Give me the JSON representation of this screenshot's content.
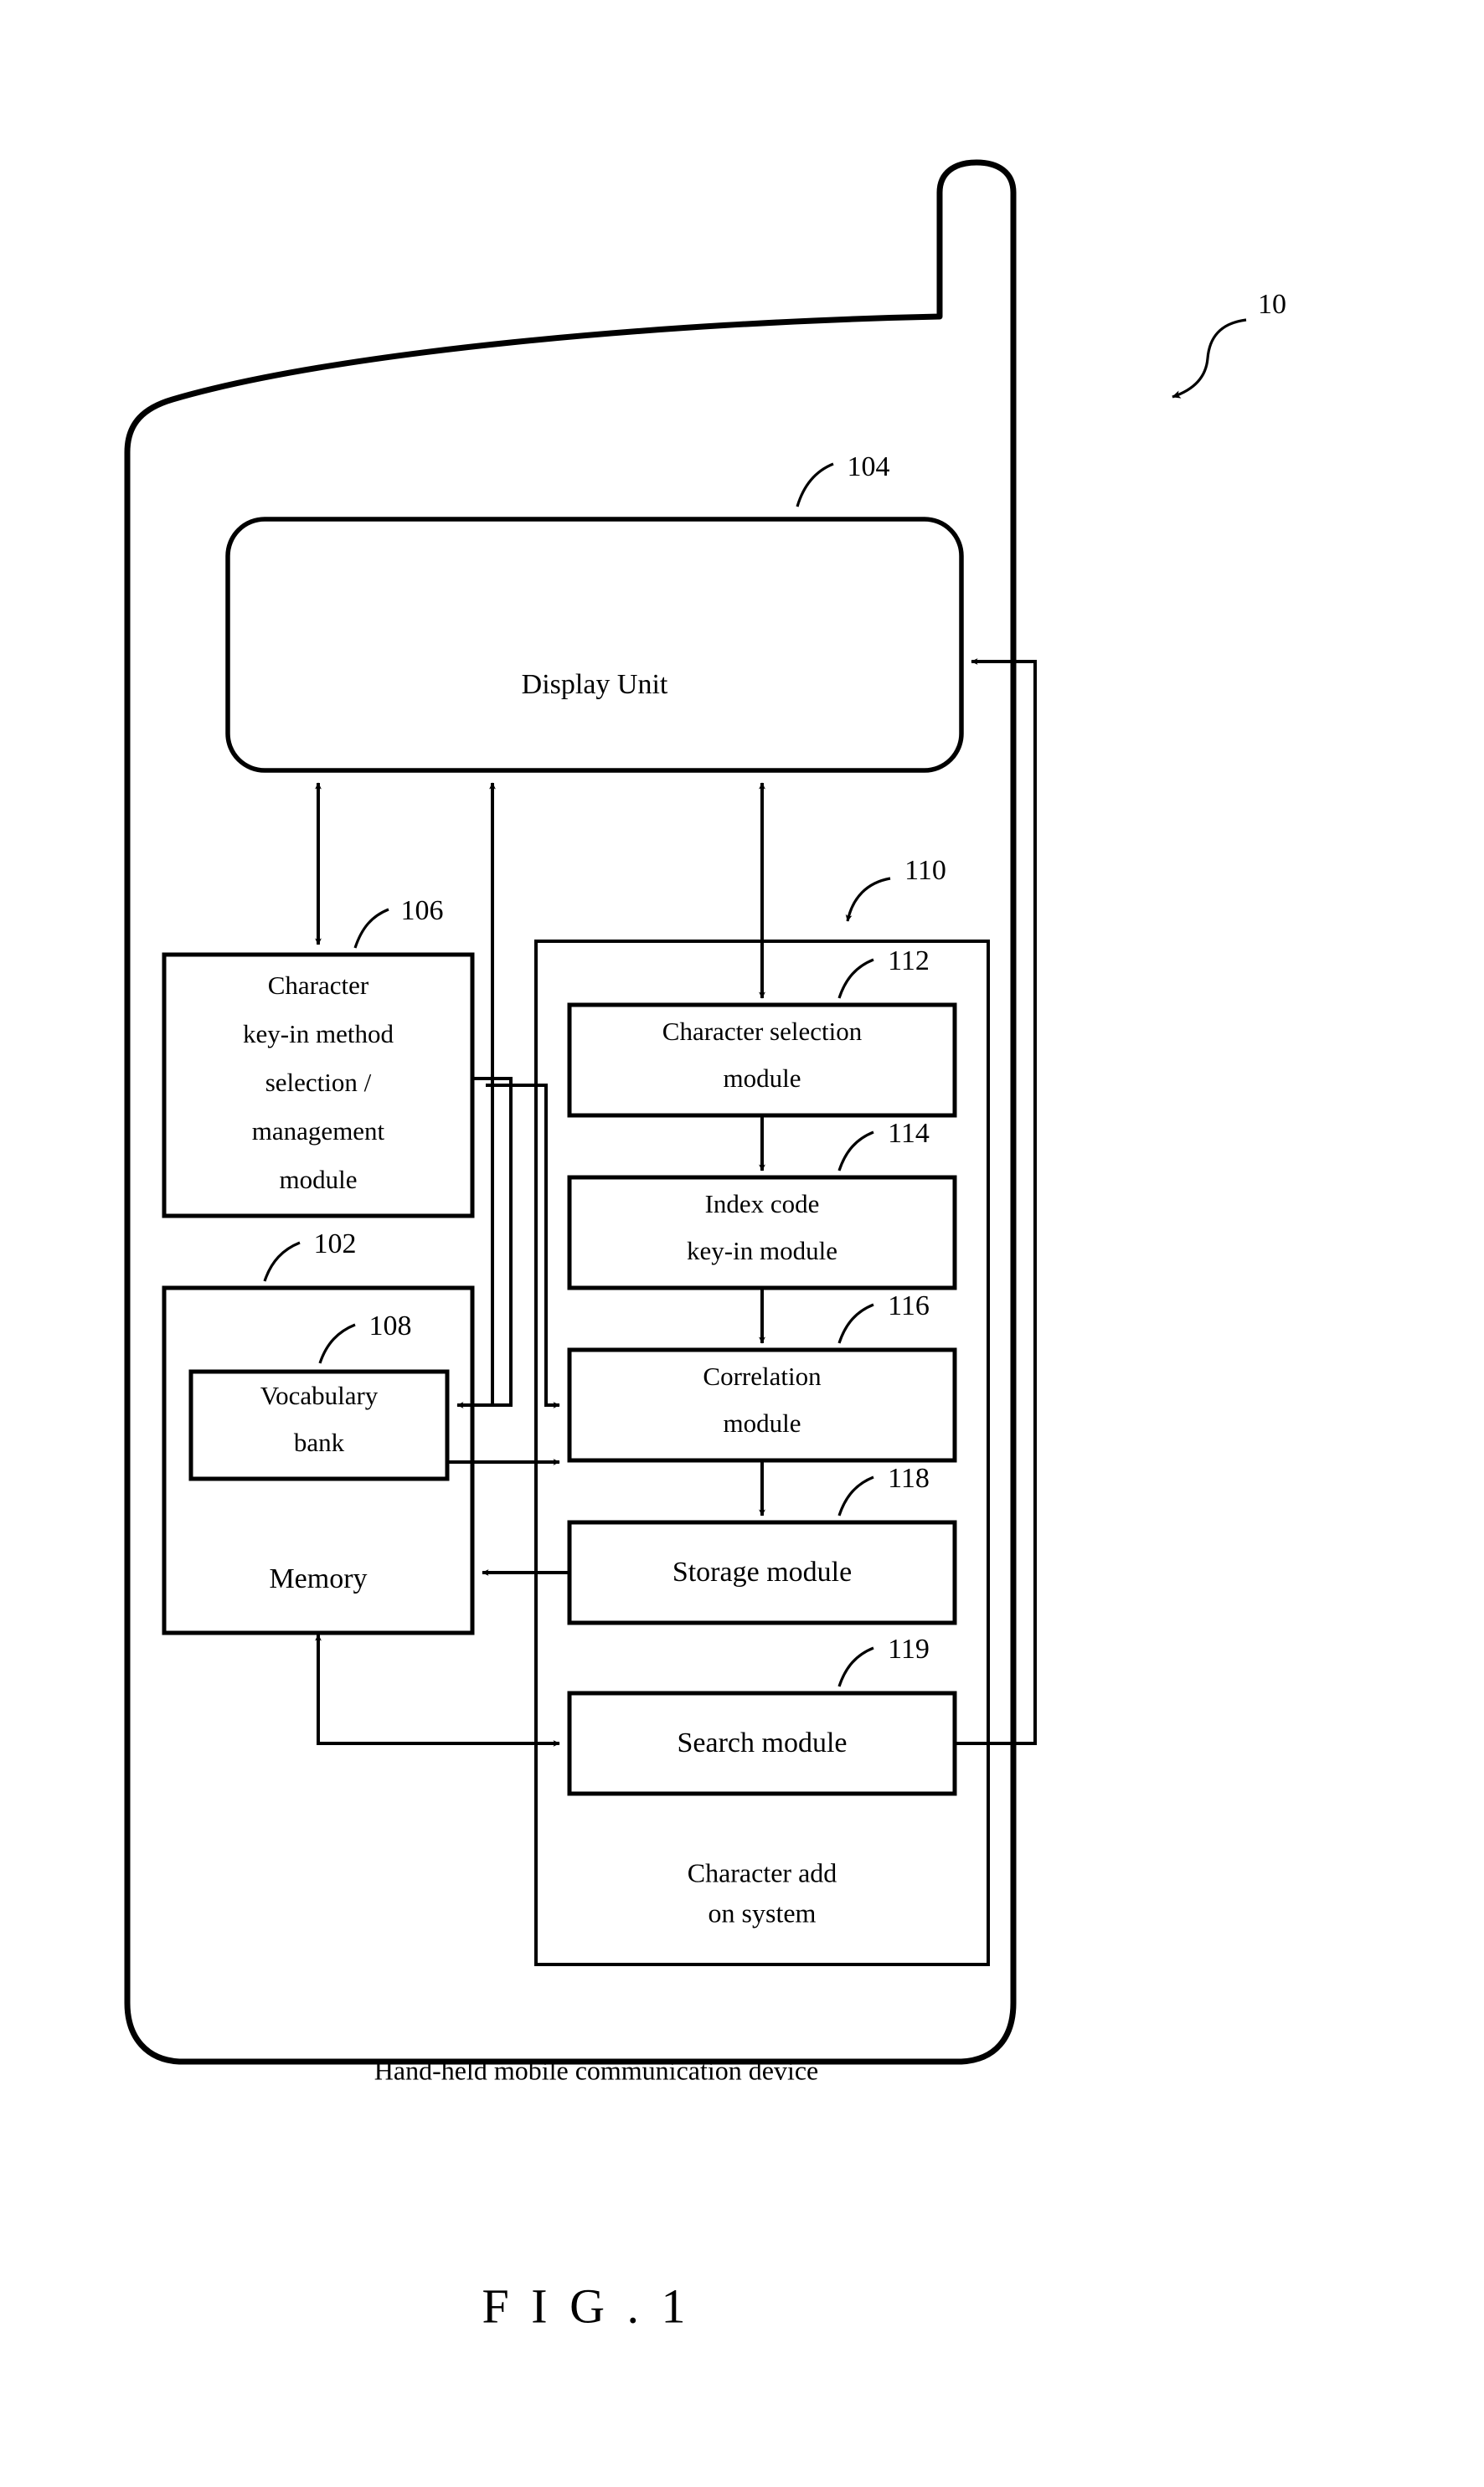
{
  "figure": {
    "caption": "F I G . 1",
    "device_label": "Hand-held mobile communication device",
    "device_ref": "10",
    "system_label_line1": "Character add",
    "system_label_line2": "on system",
    "system_ref": "110"
  },
  "blocks": {
    "display": {
      "label": "Display Unit",
      "ref": "104"
    },
    "keyin_method": {
      "line1": "Character",
      "line2": "key-in method",
      "line3": "selection /",
      "line4": "management",
      "line5": "module",
      "ref": "106"
    },
    "memory": {
      "label": "Memory",
      "ref": "102"
    },
    "vocabulary_bank": {
      "line1": "Vocabulary",
      "line2": "bank",
      "ref": "108"
    },
    "character_selection": {
      "line1": "Character selection",
      "line2": "module",
      "ref": "112"
    },
    "index_code_keyin": {
      "line1": "Index code",
      "line2": "key-in module",
      "ref": "114"
    },
    "correlation": {
      "line1": "Correlation",
      "line2": "module",
      "ref": "116"
    },
    "storage": {
      "label": "Storage module",
      "ref": "118"
    },
    "search": {
      "label": "Search module",
      "ref": "119"
    }
  },
  "colors": {
    "ink": "#000000",
    "paper": "#ffffff"
  }
}
